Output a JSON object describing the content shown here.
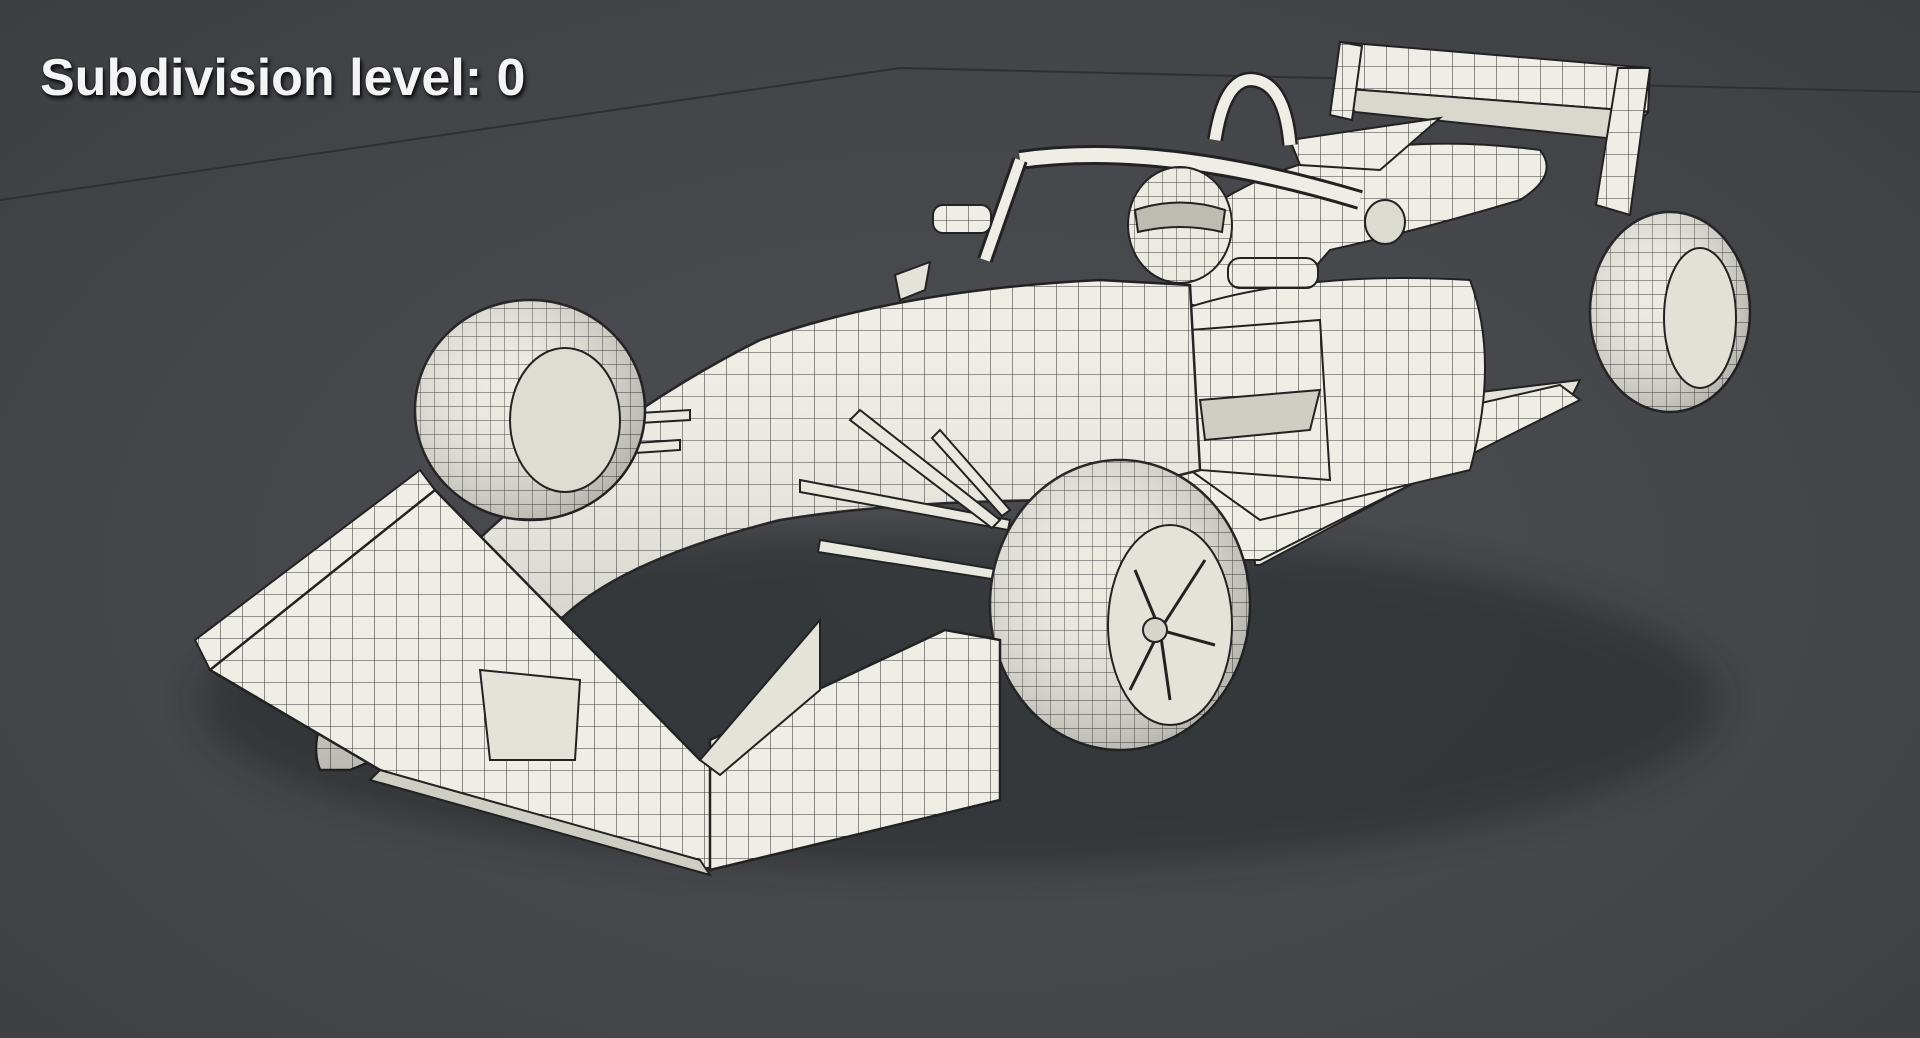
{
  "overlay": {
    "label": "Subdivision level: 0"
  },
  "scene": {
    "subject": "open-wheel-race-car-wireframe",
    "background_color": "#46484c",
    "model_surface_color": "#efeee6",
    "wire_color": "#2a2a2a"
  }
}
